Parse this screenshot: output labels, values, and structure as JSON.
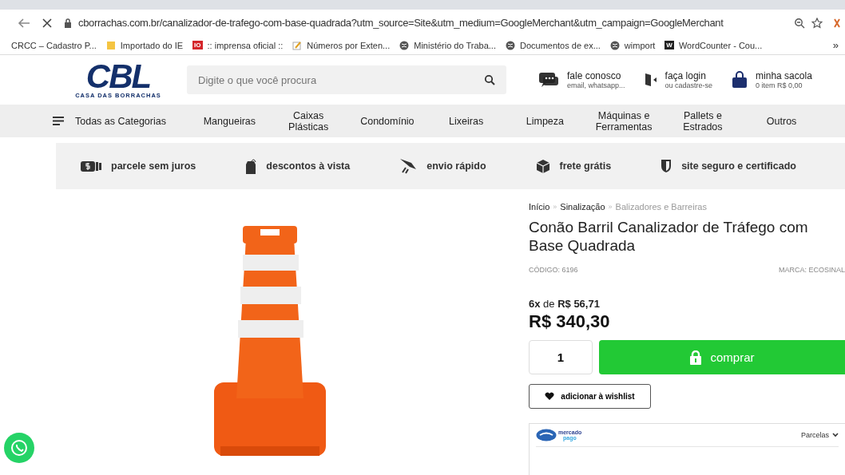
{
  "browser": {
    "url": "cborrachas.com.br/canalizador-de-trafego-com-base-quadrada?utm_source=Site&utm_medium=GoogleMerchant&utm_campaign=GoogleMerchant",
    "bookmarks": [
      {
        "kind": "plain",
        "label": "CRCC – Cadastro P..."
      },
      {
        "kind": "folder",
        "label": "Importado do IE"
      },
      {
        "kind": "badge",
        "badge": "IO",
        "label": ":: imprensa oficial ::"
      },
      {
        "kind": "pencil",
        "label": "Números por Exten..."
      },
      {
        "kind": "globe",
        "label": "Ministério do Traba..."
      },
      {
        "kind": "globe",
        "label": "Documentos de ex..."
      },
      {
        "kind": "globe",
        "label": "wimport"
      },
      {
        "kind": "letter",
        "badge": "W",
        "label": "WordCounter - Cou..."
      }
    ],
    "more": "»"
  },
  "header": {
    "logo": "CBL",
    "logo_sub": "CASA DAS BORRACHAS",
    "search": {
      "placeholder": "Digite o que você procura"
    },
    "actions": [
      {
        "kind": "chat",
        "title": "fale conosco",
        "sub": "email, whatsapp..."
      },
      {
        "kind": "login",
        "title": "faça login",
        "sub": "ou cadastre-se"
      },
      {
        "kind": "bag",
        "title": "minha sacola",
        "sub": "0 item R$ 0,00"
      }
    ]
  },
  "nav": {
    "all": "Todas as Categorias",
    "items": [
      "Mangueiras",
      "Caixas\nPlásticas",
      "Condomínio",
      "Lixeiras",
      "Limpeza",
      "Máquinas e\nFerramentas",
      "Pallets e\nEstrados",
      "Outros"
    ]
  },
  "perks": [
    {
      "kind": "money",
      "label": "parcele sem juros"
    },
    {
      "kind": "tag",
      "label": "descontos à vista"
    },
    {
      "kind": "rocket",
      "label": "envio rápido"
    },
    {
      "kind": "box",
      "label": "frete grátis"
    },
    {
      "kind": "shield",
      "label": "site seguro e certificado"
    }
  ],
  "product": {
    "breadcrumb": [
      {
        "label": "Início",
        "current": false
      },
      {
        "label": "Sinalização",
        "current": false
      },
      {
        "label": "Balizadores e Barreiras",
        "current": true
      }
    ],
    "separator": "»",
    "title": "Conão Barril Canalizador de Tráfego com Base Quadrada",
    "code": "CÓDIGO: 6196",
    "brand": "MARCA: ECOSINAL",
    "installments": "**6x** de **R$ 56,71**",
    "price": "R$ 340,30",
    "quantity": "1",
    "buy": "comprar",
    "wishlist": "adicionar à wishlist",
    "payment": {
      "logo_top": "mercado",
      "logo_bottom": "pago",
      "dropdown": "Parcelas"
    }
  }
}
